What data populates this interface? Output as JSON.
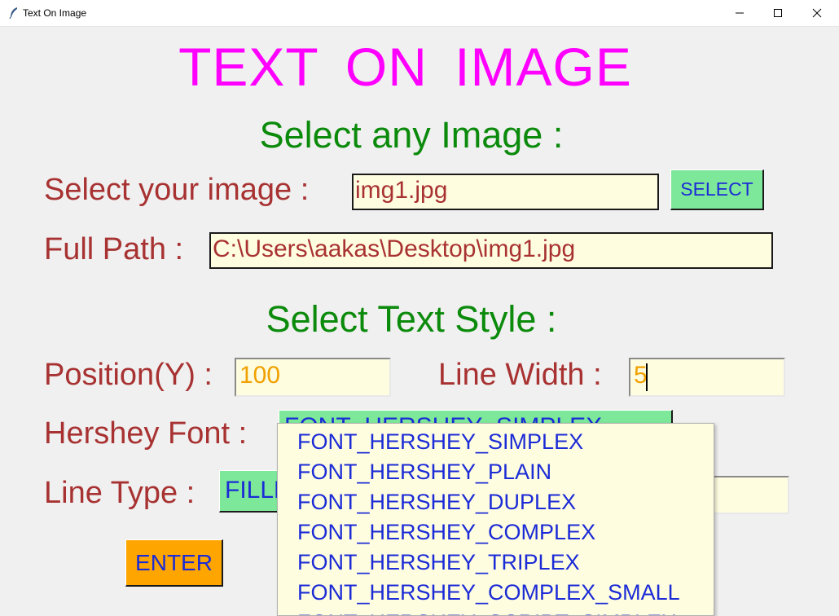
{
  "window": {
    "title": "Text On Image",
    "controls": {
      "minimize": "minimize",
      "maximize": "maximize",
      "close": "close"
    }
  },
  "app": {
    "title": "TEXT  ON  IMAGE",
    "image_section_heading": "Select any Image :",
    "select_image_label": "Select your image  :",
    "select_image_value": "img1.jpg",
    "select_button": "SELECT",
    "full_path_label": "Full Path :",
    "full_path_value": "C:\\Users\\aakas\\Desktop\\img1.jpg",
    "style_section_heading": "Select Text Style :",
    "position_y_label": "Position(Y) :",
    "position_y_value": "100",
    "line_width_label": "Line Width :",
    "line_width_value": "5",
    "hershey_font_label": "Hershey Font :",
    "hershey_font_selected": "FONT_HERSHEY_SIMPLEX",
    "line_type_label": "Line Type :",
    "line_type_selected": "FILLED",
    "enter_button": "ENTER"
  },
  "font_dropdown": {
    "items": [
      "FONT_HERSHEY_SIMPLEX",
      "FONT_HERSHEY_PLAIN",
      "FONT_HERSHEY_DUPLEX",
      "FONT_HERSHEY_COMPLEX",
      "FONT_HERSHEY_TRIPLEX",
      "FONT_HERSHEY_COMPLEX_SMALL",
      "FONT_HERSHEY_SCRIPT_SIMPLEX"
    ]
  },
  "colors": {
    "title": "#ff00ff",
    "heading": "#0b8a0b",
    "label": "#a83232",
    "entry_bg": "#fffde0",
    "button_green": "#7ee89a",
    "button_orange": "#ffa500",
    "button_text": "#1b2bd6",
    "number_text": "#f0a000"
  },
  "icons": {
    "app": "feather-icon",
    "minimize": "minimize-icon",
    "maximize": "maximize-icon",
    "close": "close-icon"
  }
}
